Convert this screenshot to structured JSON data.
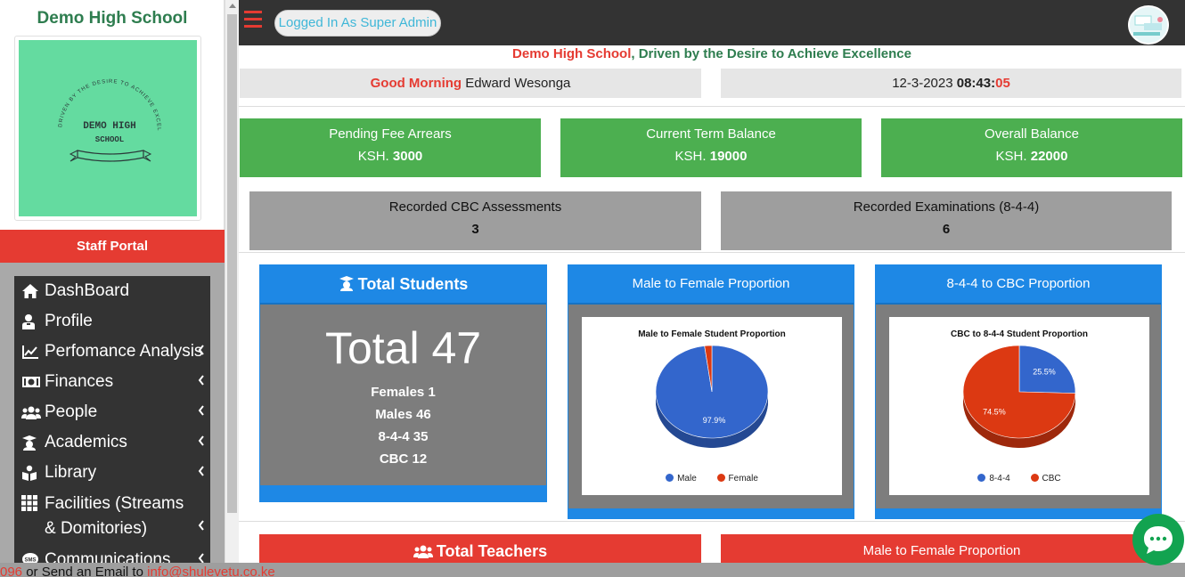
{
  "sidebar": {
    "school_name": "Demo High School",
    "logo_text_line1": "DEMO HIGH",
    "logo_text_line2": "SCHOOL",
    "logo_arc_text": "DRIVEN BY THE DESIRE TO ACHIEVE EXCELLENCE",
    "portal_label": "Staff Portal",
    "menu": [
      {
        "label": "DashBoard",
        "icon": "home-icon",
        "has_submenu": false
      },
      {
        "label": "Profile",
        "icon": "user-icon",
        "has_submenu": false
      },
      {
        "label": "Perfomance Analysis",
        "icon": "chart-line-icon",
        "has_submenu": true
      },
      {
        "label": "Finances",
        "icon": "money-icon",
        "has_submenu": true
      },
      {
        "label": "People",
        "icon": "users-icon",
        "has_submenu": true
      },
      {
        "label": "Academics",
        "icon": "graduation-cap-icon",
        "has_submenu": true
      },
      {
        "label": "Library",
        "icon": "book-reader-icon",
        "has_submenu": true
      },
      {
        "label": "Facilities (Streams & Domitories)",
        "icon": "grid-icon",
        "has_submenu": true
      },
      {
        "label": "Communications",
        "icon": "sms-icon",
        "has_submenu": true
      }
    ]
  },
  "topbar": {
    "logged_in_label": "Logged In As Super Admin"
  },
  "tagline": {
    "school": "Demo High School",
    "separator": ",",
    "motto": "Driven by the Desire to Achieve Excellence"
  },
  "greeting": {
    "salutation": "Good Morning",
    "name": "Edward Wesonga"
  },
  "datetime": {
    "date": "12-3-2023",
    "hm": "08:43:",
    "seconds": "05"
  },
  "finance_cards": [
    {
      "title": "Pending Fee Arrears",
      "currency": "KSH.",
      "amount": "3000"
    },
    {
      "title": "Current Term Balance",
      "currency": "KSH.",
      "amount": "19000"
    },
    {
      "title": "Overall Balance",
      "currency": "KSH.",
      "amount": "22000"
    }
  ],
  "record_cards": [
    {
      "title": "Recorded CBC Assessments",
      "value": "3"
    },
    {
      "title": "Recorded Examinations (8-4-4)",
      "value": "6"
    }
  ],
  "students_panel": {
    "title": "Total Students",
    "total_label": "Total 47",
    "females": {
      "label": "Females",
      "value": "1"
    },
    "males": {
      "label": "Males",
      "value": "46"
    },
    "s844": {
      "label": "8-4-4",
      "value": "35"
    },
    "cbc": {
      "label": "CBC",
      "value": "12"
    }
  },
  "gender_panel": {
    "title": "Male to Female Proportion"
  },
  "curriculum_panel": {
    "title": "8-4-4 to CBC Proportion"
  },
  "chart_data": [
    {
      "type": "pie",
      "title": "Male to Female Student Proportion",
      "labels": [
        "Male",
        "Female"
      ],
      "values": [
        97.9,
        2.1
      ],
      "colors": [
        "#3366cc",
        "#dc3912"
      ],
      "slice_labels": [
        "97.9%",
        ""
      ],
      "legend": "bottom"
    },
    {
      "type": "pie",
      "title": "CBC to 8-4-4 Student Proportion",
      "labels": [
        "8-4-4",
        "CBC"
      ],
      "values": [
        25.5,
        74.5
      ],
      "colors": [
        "#3366cc",
        "#dc3912"
      ],
      "slice_labels": [
        "25.5%",
        "74.5%"
      ],
      "legend": "bottom"
    }
  ],
  "teachers_panel": {
    "title": "Total Teachers",
    "gender_title": "Male to Female Proportion"
  },
  "footer": {
    "phone_fragment": "096",
    "text": " or Send an Email to ",
    "email": "info@shulevetu.co.ke"
  },
  "colors": {
    "topbar": "#333333",
    "accent_red": "#e53b32",
    "green_card": "#4caf50",
    "panel_blue": "#1e88e5",
    "brand_green": "#2e7d4f"
  }
}
